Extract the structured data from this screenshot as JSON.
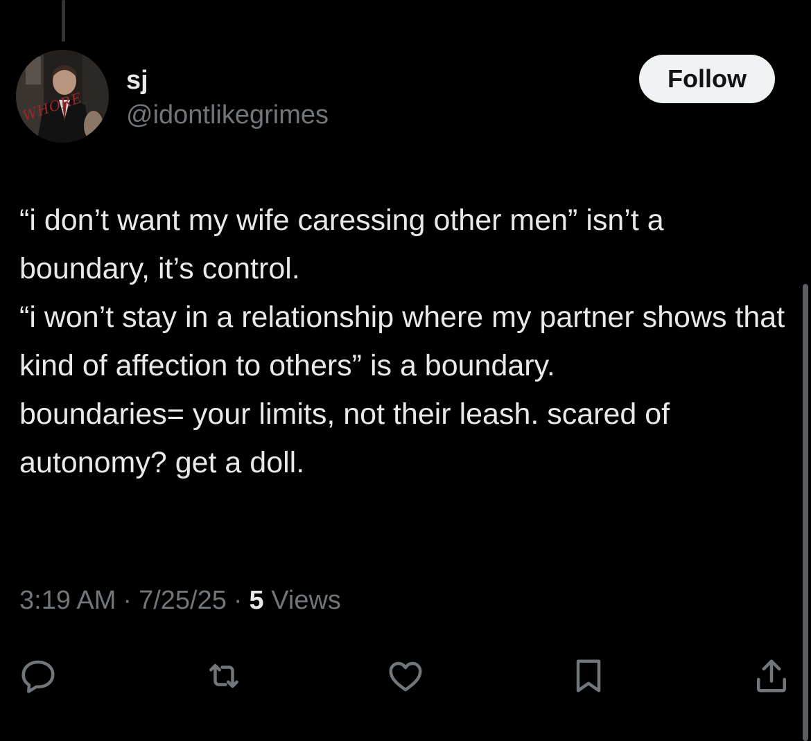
{
  "user": {
    "display_name": "sj",
    "handle": "@idontlikegrimes",
    "avatar_overlay_text": "WHORE"
  },
  "follow_label": "Follow",
  "tweet": {
    "paragraphs": [
      "“i don’t want my wife caressing other men” isn’t a boundary, it’s control.",
      "“i won’t stay in a relationship where my partner shows that kind of affection to others” is a boundary.",
      "boundaries= your limits, not their leash. scared of autonomy? get a doll."
    ]
  },
  "meta": {
    "time": "3:19 AM",
    "date": "7/25/25",
    "views_count": "5",
    "views_label": "Views",
    "separator": "·"
  },
  "actions": [
    "reply-icon",
    "retweet-icon",
    "like-icon",
    "bookmark-icon",
    "share-icon"
  ],
  "colors": {
    "background": "#000000",
    "text": "#e7e9ea",
    "secondary": "#71767b",
    "follow_bg": "#eff3f4",
    "icon": "#71767b"
  }
}
